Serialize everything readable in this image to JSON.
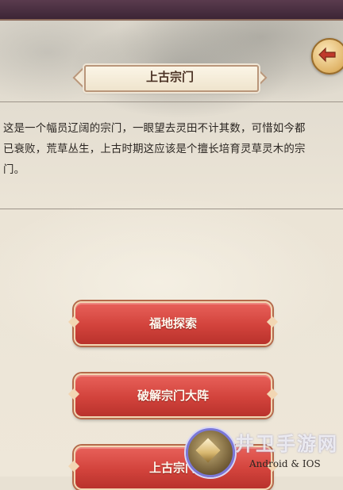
{
  "header": {
    "title": "上古宗门"
  },
  "description": {
    "lines": [
      "这是一个幅员辽阔的宗门，一眼望去灵田不计其数，可惜如今都",
      "已衰败，荒草丛生，上古时期这应该是个擅长培育灵草灵木的宗",
      "门。"
    ]
  },
  "actions": [
    {
      "label": "福地探索"
    },
    {
      "label": "破解宗门大阵"
    },
    {
      "label": "上古宗门"
    }
  ],
  "watermark": {
    "site": "井卫手游网",
    "platform": "Android & IOS"
  },
  "colors": {
    "button_red": "#d2433c",
    "parchment": "#ebe4d6",
    "title_brown": "#4b3224"
  }
}
